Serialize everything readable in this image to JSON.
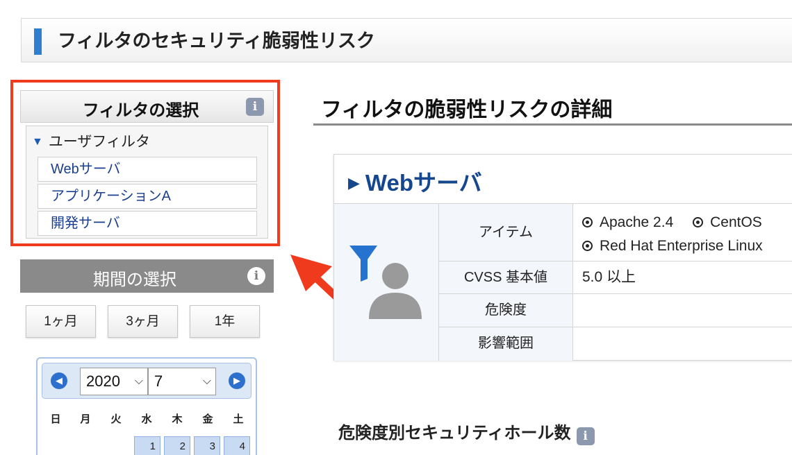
{
  "header": {
    "title": "フィルタのセキュリティ脆弱性リスク"
  },
  "filter_panel": {
    "title": "フィルタの選択",
    "group_title": "ユーザフィルタ",
    "items": [
      "Webサーバ",
      "アプリケーションA",
      "開発サーバ"
    ]
  },
  "period_panel": {
    "title": "期間の選択",
    "buttons": [
      "1ヶ月",
      "3ヶ月",
      "1年"
    ]
  },
  "calendar": {
    "year": "2020",
    "month": "7",
    "weekdays": [
      "日",
      "月",
      "火",
      "水",
      "木",
      "金",
      "土"
    ],
    "visible_days": [
      "1",
      "2",
      "3",
      "4"
    ]
  },
  "details": {
    "section_title": "フィルタの脆弱性リスクの詳細",
    "filter_name": "Webサーバ",
    "rows": [
      {
        "label": "アイテム",
        "values": [
          "Apache 2.4",
          "CentOS",
          "Red Hat Enterprise Linux"
        ]
      },
      {
        "label": "CVSS 基本値",
        "value": "5.0 以上"
      },
      {
        "label": "危険度",
        "value": ""
      },
      {
        "label": "影響範囲",
        "value": ""
      }
    ]
  },
  "holes_section": {
    "title": "危険度別セキュリティホール数"
  },
  "colors": {
    "accent": "#2f7fd0",
    "highlight": "#f03a1e",
    "link": "#1a3f8f",
    "title_blue": "#15478f"
  },
  "icons": [
    "info-icon",
    "funnel-icon",
    "user-filter-icon",
    "arrow-left-circle-icon",
    "arrow-right-circle-icon",
    "chevron-down-icon"
  ]
}
